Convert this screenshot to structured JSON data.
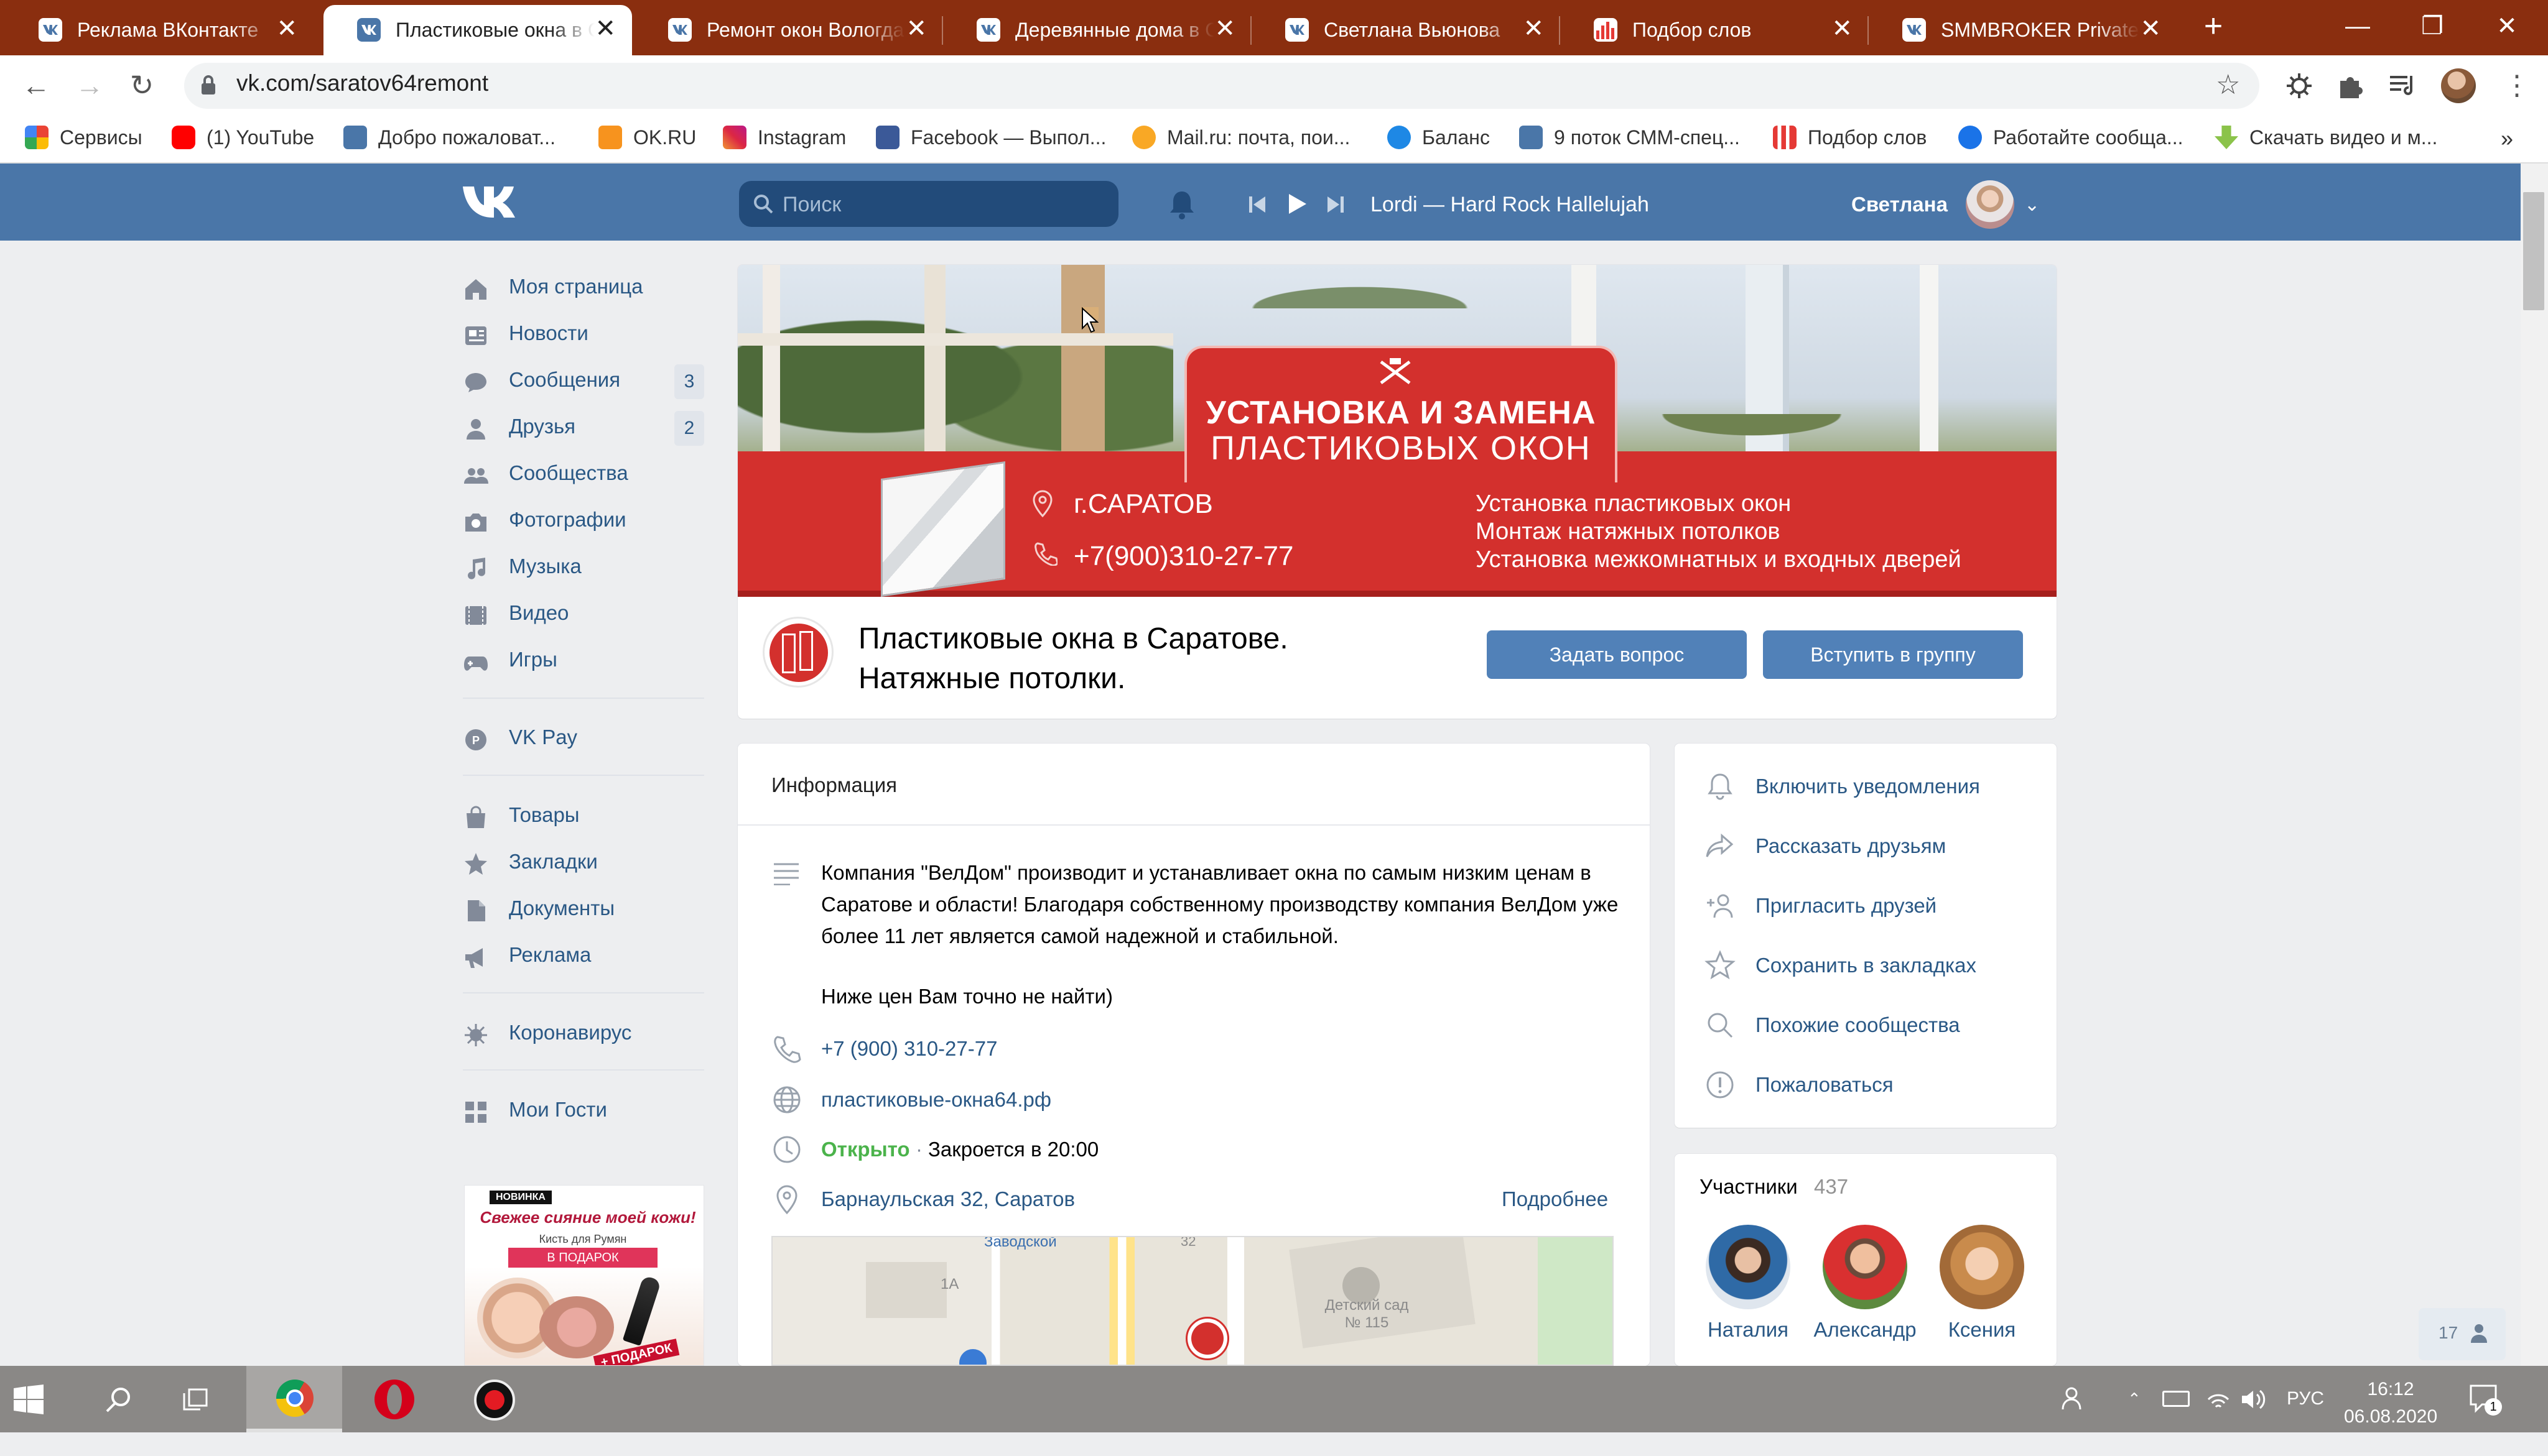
{
  "browser": {
    "tabs": [
      {
        "title": "Реклама ВКонтакте",
        "icon": "vk-icon"
      },
      {
        "title": "Пластиковые окна в Саратове",
        "icon": "vk-icon",
        "active": true
      },
      {
        "title": "Ремонт окон Вологда",
        "icon": "vk-icon"
      },
      {
        "title": "Деревянные дома в Саратове",
        "icon": "vk-icon"
      },
      {
        "title": "Светлана Вьюнова",
        "icon": "vk-icon"
      },
      {
        "title": "Подбор слов",
        "icon": "wordstat-icon"
      },
      {
        "title": "SMMBROKER Private Club",
        "icon": "vk-icon"
      }
    ],
    "url": "vk.com/saratov64remont",
    "bookmarks": [
      {
        "label": "Сервисы",
        "icon": "apps-icon",
        "color": "#e94235"
      },
      {
        "label": "(1) YouTube",
        "icon": "youtube-icon",
        "color": "#ff0000"
      },
      {
        "label": "Добро пожаловат...",
        "icon": "vk-icon",
        "color": "#4a76a8"
      },
      {
        "label": "OK.RU",
        "icon": "ok-icon",
        "color": "#f7931e"
      },
      {
        "label": "Instagram",
        "icon": "instagram-icon",
        "color": "#d6249f"
      },
      {
        "label": "Facebook — Выпол...",
        "icon": "facebook-icon",
        "color": "#3b5998"
      },
      {
        "label": "Mail.ru: почта, пои...",
        "icon": "mailru-icon",
        "color": "#005ff9"
      },
      {
        "label": "Баланс",
        "icon": "balance-icon",
        "color": "#1e88e5"
      },
      {
        "label": "9 поток СММ-спец...",
        "icon": "vk-icon",
        "color": "#4a76a8"
      },
      {
        "label": "Подбор слов",
        "icon": "wordstat-icon",
        "color": "#e53935"
      },
      {
        "label": "Работайте сообща...",
        "icon": "chrome-icon",
        "color": "#1a73e8"
      },
      {
        "label": "Скачать видео и м...",
        "icon": "download-icon",
        "color": "#8bc34a"
      }
    ]
  },
  "vk": {
    "search_placeholder": "Поиск",
    "player_track": "Lordi — Hard Rock Hallelujah",
    "user_name": "Светлана",
    "menu": [
      {
        "label": "Моя страница",
        "icon": "home-icon"
      },
      {
        "label": "Новости",
        "icon": "news-icon"
      },
      {
        "label": "Сообщения",
        "icon": "messages-icon",
        "count": "3"
      },
      {
        "label": "Друзья",
        "icon": "friends-icon",
        "count": "2"
      },
      {
        "label": "Сообщества",
        "icon": "communities-icon"
      },
      {
        "label": "Фотографии",
        "icon": "camera-icon"
      },
      {
        "label": "Музыка",
        "icon": "music-icon"
      },
      {
        "label": "Видео",
        "icon": "video-icon"
      },
      {
        "label": "Игры",
        "icon": "gamepad-icon"
      }
    ],
    "menu2": [
      {
        "label": "VK Pay",
        "icon": "vkpay-icon"
      }
    ],
    "menu3": [
      {
        "label": "Товары",
        "icon": "bag-icon"
      },
      {
        "label": "Закладки",
        "icon": "star-icon"
      },
      {
        "label": "Документы",
        "icon": "document-icon"
      },
      {
        "label": "Реклама",
        "icon": "megaphone-icon"
      }
    ],
    "menu4": [
      {
        "label": "Коронавирус",
        "icon": "virus-icon"
      }
    ],
    "menu5": [
      {
        "label": "Мои Гости",
        "icon": "apps-icon"
      }
    ],
    "ad": {
      "badge": "НОВИНКА",
      "headline": "Свежее сияние моей кожи!",
      "line": "Кисть для Румян",
      "promo": "В ПОДАРОК",
      "sticker": "+ ПОДАРОК"
    }
  },
  "group": {
    "cover": {
      "headline_1": "УСТАНОВКА И ЗАМЕНА",
      "headline_2": "ПЛАСТИКОВЫХ ОКОН",
      "city": "г.САРАТОВ",
      "phone": "+7(900)310-27-77",
      "services": [
        "Установка пластиковых окон",
        "Монтаж натяжных потолков",
        "Установка межкомнатных и входных дверей"
      ]
    },
    "title_line_1": "Пластиковые окна в Саратове.",
    "title_line_2": "Натяжные потолки.",
    "ask_button": "Задать вопрос",
    "join_button": "Вступить в группу",
    "info": {
      "heading": "Информация",
      "description": "Компания \"ВелДом\" производит и устанавливает окна по самым низким ценам в Саратове и области! Благодаря собственному производству компания ВелДом уже более 11 лет является самой надежной и стабильной.",
      "description_2": "Ниже цен Вам точно не найти)",
      "phone": "+7 (900) 310-27-77",
      "site": "пластиковые-окна64.рф",
      "open_status": "Открыто",
      "closes": "Закроется в 20:00",
      "address": "Барнаульская 32, Саратов",
      "more_link": "Подробнее",
      "map_labels": [
        "Заводской",
        "1А",
        "32",
        "Детский сад № 115"
      ]
    },
    "actions": [
      {
        "label": "Включить уведомления",
        "icon": "bell-icon"
      },
      {
        "label": "Рассказать друзьям",
        "icon": "share-icon"
      },
      {
        "label": "Пригласить друзей",
        "icon": "add-person-icon"
      },
      {
        "label": "Сохранить в закладках",
        "icon": "star-icon"
      },
      {
        "label": "Похожие сообщества",
        "icon": "search-icon"
      },
      {
        "label": "Пожаловаться",
        "icon": "warning-icon"
      }
    ],
    "members": {
      "heading": "Участники",
      "count": "437",
      "people": [
        "Наталия",
        "Александр",
        "Ксения"
      ]
    },
    "online_count": "17"
  },
  "taskbar": {
    "lang": "РУС",
    "time": "16:12",
    "date": "06.08.2020",
    "notifications": "1"
  },
  "colors": {
    "vk_blue": "#4a76a8",
    "link": "#2a5885",
    "open_green": "#4bb34b",
    "banner_red": "#d3302d"
  }
}
